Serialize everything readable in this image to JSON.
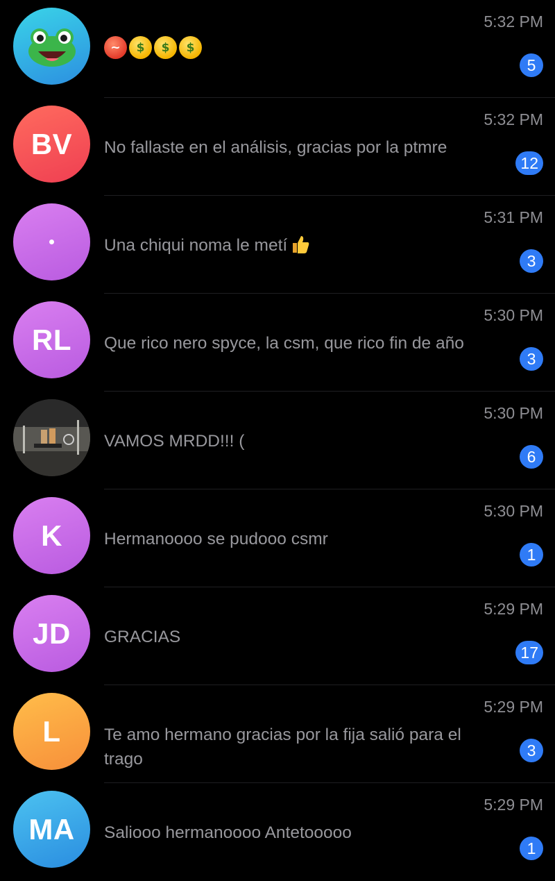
{
  "chats": [
    {
      "time": "5:32 PM",
      "badge": "5",
      "avatar_type": "frog",
      "avatar_color": "#38b8e6",
      "message_emojis": [
        "hot-face",
        "money-mouth-face",
        "money-mouth-face",
        "money-mouth-face"
      ]
    },
    {
      "time": "5:32 PM",
      "badge": "12",
      "avatar_type": "initials",
      "initials": "BV",
      "avatar_color": "#f4564f",
      "message": "No fallaste en el análisis, gracias por la ptmre"
    },
    {
      "time": "5:31 PM",
      "badge": "3",
      "avatar_type": "dot",
      "avatar_color": "#c96ee6",
      "message": "Una chiqui noma le metí",
      "message_emoji": "thumbs-up"
    },
    {
      "time": "5:30 PM",
      "badge": "3",
      "avatar_type": "initials",
      "initials": "RL",
      "avatar_color": "#c96ee6",
      "message": "Que rico nero spyce, la csm, que rico fin de año"
    },
    {
      "time": "5:30 PM",
      "badge": "6",
      "avatar_type": "photo",
      "message": "VAMOS MRDD!!! ("
    },
    {
      "time": "5:30 PM",
      "badge": "1",
      "avatar_type": "initials",
      "initials": "K",
      "avatar_color": "#c96ee6",
      "message": "Hermanoooo se pudooo csmr"
    },
    {
      "time": "5:29 PM",
      "badge": "17",
      "avatar_type": "initials",
      "initials": "JD",
      "avatar_color": "#c96ee6",
      "message": "GRACIAS"
    },
    {
      "time": "5:29 PM",
      "badge": "3",
      "avatar_type": "initials",
      "initials": "L",
      "avatar_color": "#f9a23e",
      "message": "Te amo hermano gracias por la fija salió para el trago"
    },
    {
      "time": "5:29 PM",
      "badge": "1",
      "avatar_type": "initials",
      "initials": "MA",
      "avatar_color": "#3aa6ea",
      "message": "Saliooo hermanoooo Antetooooo"
    }
  ],
  "colors": {
    "badge": "#2f7bf6",
    "time": "#8e8e93",
    "message": "#98989d",
    "background": "#000000"
  }
}
